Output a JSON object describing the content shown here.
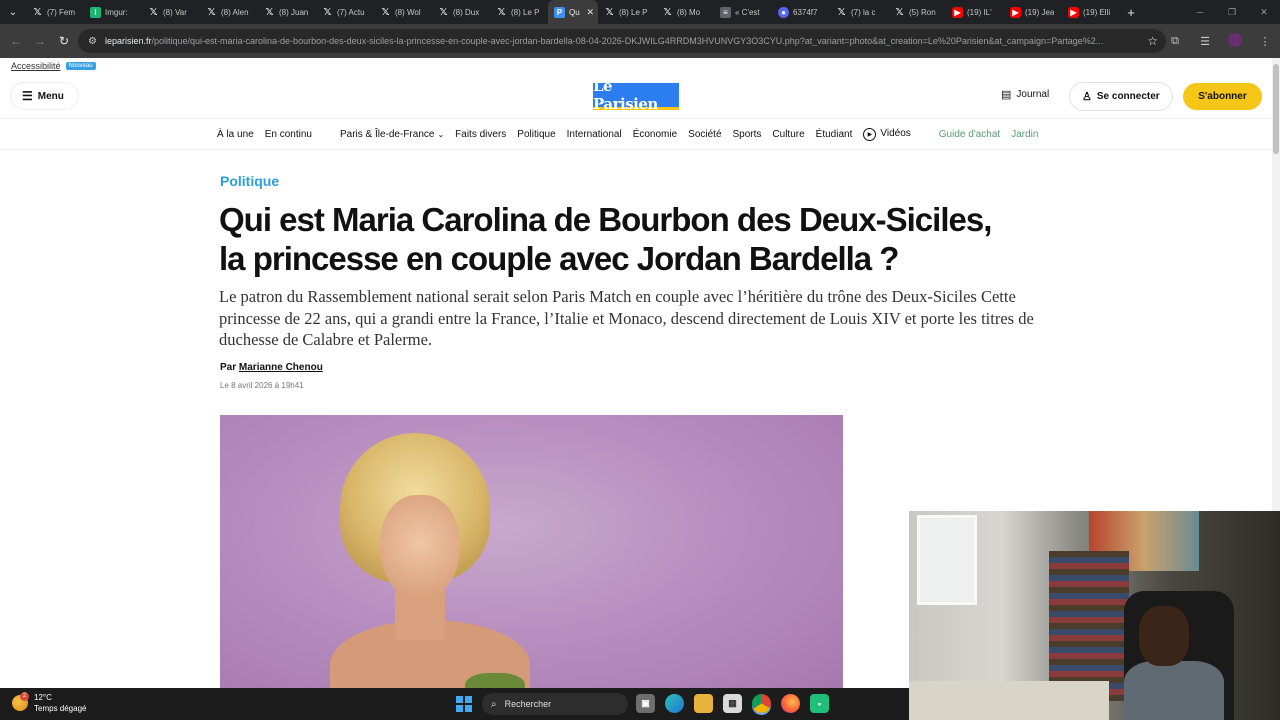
{
  "browser": {
    "tabs": [
      {
        "icon": "x",
        "title": "(7) Fem"
      },
      {
        "icon": "imgur",
        "title": "Imgur:"
      },
      {
        "icon": "x",
        "title": "(8) Var"
      },
      {
        "icon": "x",
        "title": "(8) Alen"
      },
      {
        "icon": "x",
        "title": "(8) Juan"
      },
      {
        "icon": "x",
        "title": "(7) Actu"
      },
      {
        "icon": "x",
        "title": "(8) Wol"
      },
      {
        "icon": "x",
        "title": "(8) Dux"
      },
      {
        "icon": "x",
        "title": "(8) Le P"
      },
      {
        "icon": "leparisien",
        "title": "Qu",
        "active": true
      },
      {
        "icon": "x",
        "title": "(8) Le P"
      },
      {
        "icon": "x",
        "title": "(8) Mo"
      },
      {
        "icon": "file",
        "title": "« C'est"
      },
      {
        "icon": "discord",
        "title": "6374f7"
      },
      {
        "icon": "x",
        "title": "(7) la c"
      },
      {
        "icon": "x",
        "title": "(5) Ron"
      },
      {
        "icon": "youtube",
        "title": "(19) IL'"
      },
      {
        "icon": "youtube",
        "title": "(19) Jea"
      },
      {
        "icon": "youtube",
        "title": "(19) Elli"
      }
    ],
    "url_domain": "leparisien.fr",
    "url_path": "/politique/qui-est-maria-carolina-de-bourbon-des-deux-siciles-la-princesse-en-couple-avec-jordan-bardella-08-04-2026-DKJWILG4RRDM3HVUNVGY3O3CYU.php?at_variant=photo&at_creation=Le%20Parisien&at_campaign=Partage%2..."
  },
  "site": {
    "accessibility": "Accessibilité",
    "accessibility_badge": "Nouveau",
    "menu_label": "Menu",
    "logo_text": "Le Parisien",
    "journal_label": "Journal",
    "login_label": "Se connecter",
    "subscribe_label": "S'abonner",
    "nav": [
      "À la une",
      "En continu",
      "Paris & Île-de-France",
      "Faits divers",
      "Politique",
      "International",
      "Économie",
      "Société",
      "Sports",
      "Culture",
      "Étudiant",
      "Vidéos",
      "Guide d'achat",
      "Jardin"
    ]
  },
  "article": {
    "rubric": "Politique",
    "title": "Qui est Maria Carolina de Bourbon des Deux-Siciles, la princesse en couple avec Jordan Bardella ?",
    "lead": "Le patron du Rassemblement national serait selon Paris Match en couple avec l’héritière du trône des Deux-Siciles Cette princesse de 22 ans, qui a grandi entre la France, l’Italie et Monaco, descend directement de Louis XIV et porte les titres de duchesse de Calabre et Palerme.",
    "byline_prefix": "Par",
    "author": "Marianne Chenou",
    "date": "Le 8 avril 2026 à 19h41"
  },
  "taskbar": {
    "temperature": "12°C",
    "weather": "Temps dégagé",
    "weather_badge": "2",
    "search_placeholder": "Rechercher"
  },
  "colors": {
    "brand_blue": "#2c7ef0",
    "subscribe_yellow": "#f5c518",
    "rubric_blue": "#2a9fd8"
  }
}
